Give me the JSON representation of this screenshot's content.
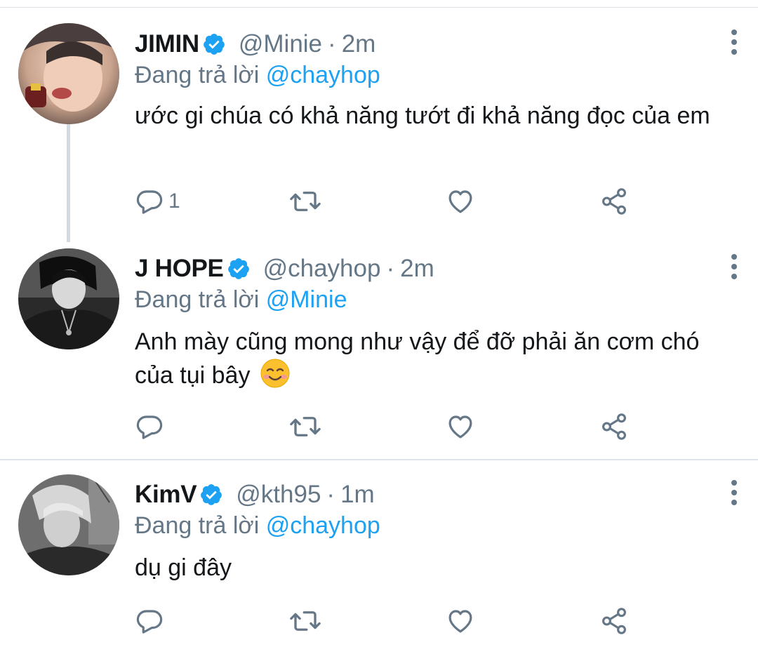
{
  "tweets": [
    {
      "name": "JIMIN",
      "handle": "@Minie",
      "separator": "·",
      "time": "2m",
      "reply_prefix": "Đang trả lời",
      "reply_to": "@chayhop",
      "text": "ước gi chúa có khả năng tướt đi khả năng đọc của em",
      "reply_count": "1",
      "avatar_icon": "avatar-photo"
    },
    {
      "name": "J HOPE",
      "handle": "@chayhop",
      "separator": "·",
      "time": "2m",
      "reply_prefix": "Đang trả lời",
      "reply_to": "@Minie",
      "text": "Anh mày cũng mong như vậy để đỡ phải ăn cơm chó của tụi bây",
      "emoji": "smiling-face-emoji",
      "reply_count": "",
      "avatar_icon": "avatar-photo"
    },
    {
      "name": "KimV",
      "handle": "@kth95",
      "separator": "·",
      "time": "1m",
      "reply_prefix": "Đang trả lời",
      "reply_to": "@chayhop",
      "text": "dụ gi đây",
      "reply_count": "",
      "avatar_icon": "avatar-photo"
    }
  ],
  "colors": {
    "verified": "#1da1f2",
    "mention": "#1da1f2",
    "secondary_text": "#657786",
    "icon": "#657786"
  },
  "icons": [
    "reply-icon",
    "retweet-icon",
    "like-icon",
    "share-icon",
    "more-options-icon",
    "verified-badge-icon"
  ]
}
